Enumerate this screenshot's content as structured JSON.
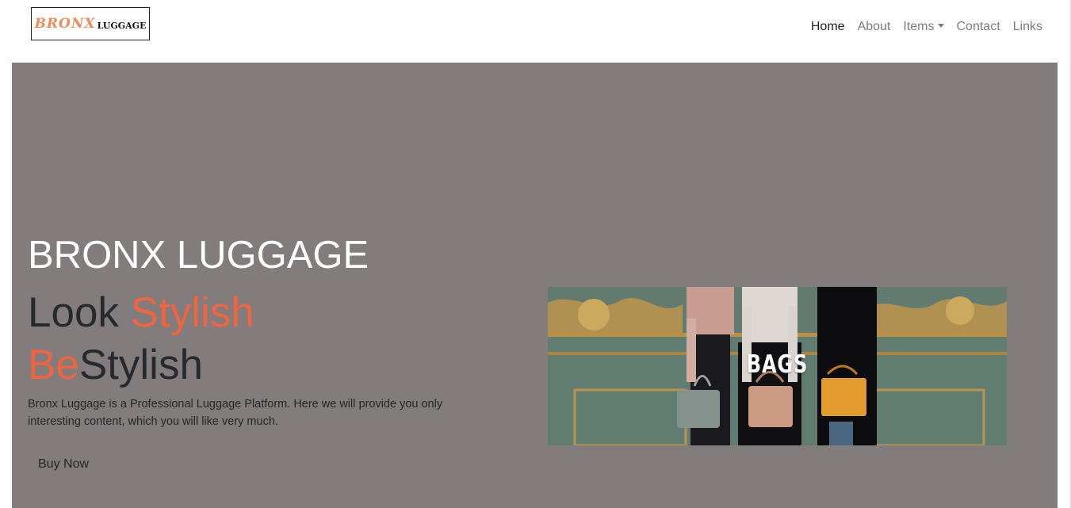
{
  "logo": {
    "part1": "BRONX",
    "part2": "LUGGAGE"
  },
  "nav": [
    {
      "label": "Home",
      "active": true
    },
    {
      "label": "About"
    },
    {
      "label": "Items",
      "dropdown": true
    },
    {
      "label": "Contact"
    },
    {
      "label": "Links"
    }
  ],
  "hero": {
    "brand_title": "BRONX LUGGAGE",
    "tagline": {
      "w1": "Look ",
      "w2": "Stylish",
      "w3": "Be",
      "w4": "Stylish"
    },
    "description": "Bronx Luggage is a Professional Luggage Platform. Here we will provide you only interesting content, which you will like very much.",
    "cta": "Buy Now",
    "banner_text": "BAGS"
  },
  "colors": {
    "accent": "#f0643f",
    "hero_bg": "#827c7c",
    "logo_accent": "#f08a5d"
  }
}
